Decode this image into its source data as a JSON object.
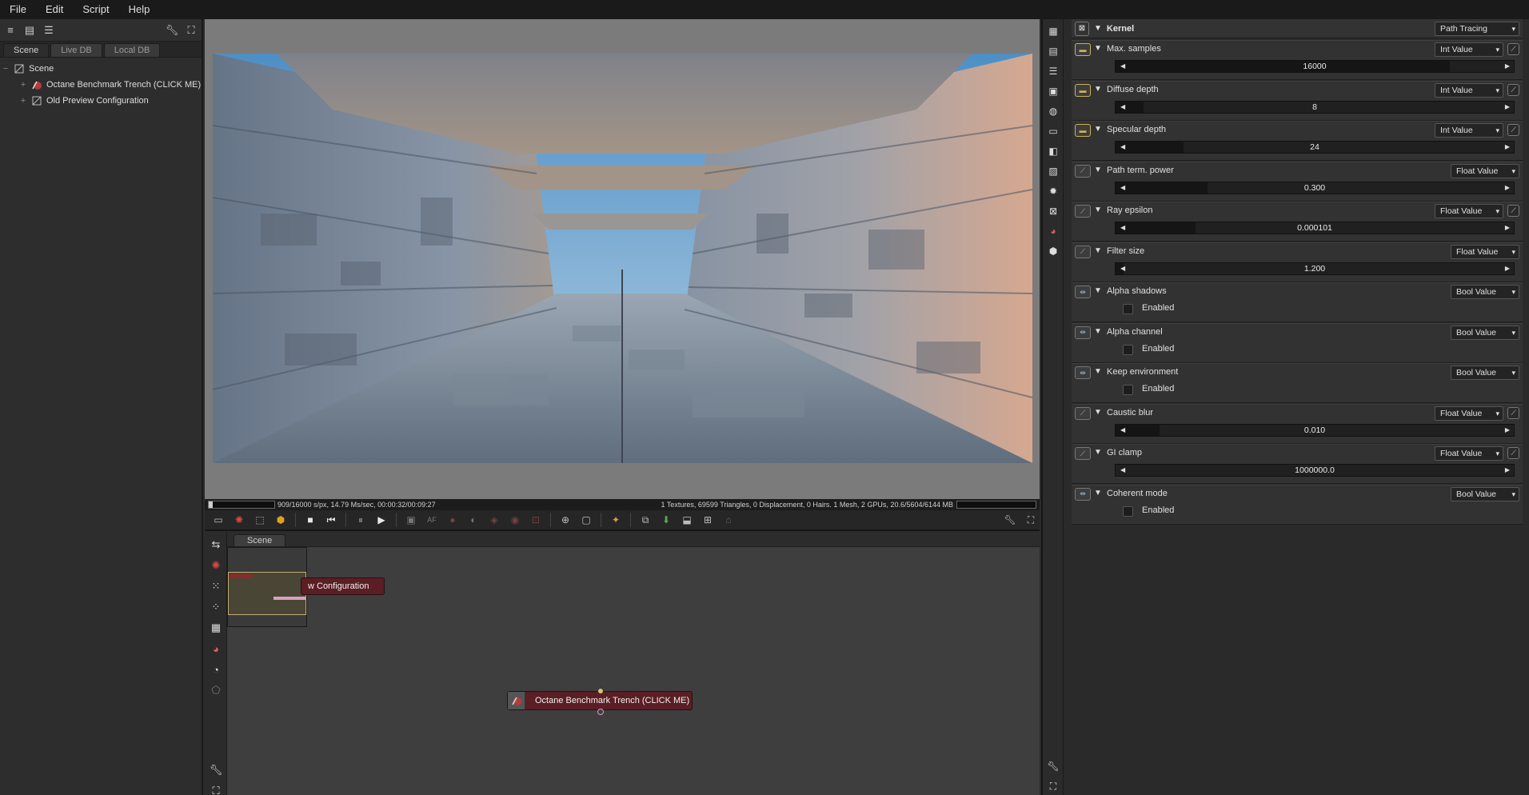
{
  "menu": [
    "File",
    "Edit",
    "Script",
    "Help"
  ],
  "left_panel": {
    "tabs": [
      "Scene",
      "Live DB",
      "Local DB"
    ],
    "tree": {
      "root": "Scene",
      "children": [
        "Octane Benchmark Trench (CLICK ME)",
        "Old Preview Configuration"
      ]
    }
  },
  "render": {
    "status_left": "909/16000 s/px, 14.79 Ms/sec, 00:00:32/00:09:27",
    "status_right": "1 Textures, 69599 Triangles, 0 Displacement, 0 Hairs. 1 Mesh, 2 GPUs, 20.6/5604/6144 MB",
    "progress": 0.057
  },
  "node_editor": {
    "tab": "Scene",
    "node_config": "w Configuration",
    "node_benchmark": "Octane Benchmark Trench (CLICK ME)"
  },
  "inspector": {
    "title": "Kernel",
    "kernel_type": "Path Tracing",
    "enabled_label": "Enabled",
    "params": [
      {
        "label": "Max. samples",
        "type": "Int Value",
        "value": "16000",
        "fill": 0.84
      },
      {
        "label": "Diffuse depth",
        "type": "Int Value",
        "value": "8",
        "fill": 0.07
      },
      {
        "label": "Specular depth",
        "type": "Int Value",
        "value": "24",
        "fill": 0.17
      },
      {
        "label": "Path term. power",
        "type": "Float Value",
        "value": "0.300",
        "fill": 0.23
      },
      {
        "label": "Ray epsilon",
        "type": "Float Value",
        "value": "0.000101",
        "fill": 0.2
      },
      {
        "label": "Filter size",
        "type": "Float Value",
        "value": "1.200",
        "fill": 0.02
      },
      {
        "label": "Alpha shadows",
        "type": "Bool Value"
      },
      {
        "label": "Alpha channel",
        "type": "Bool Value"
      },
      {
        "label": "Keep environment",
        "type": "Bool Value"
      },
      {
        "label": "Caustic blur",
        "type": "Float Value",
        "value": "0.010",
        "fill": 0.11
      },
      {
        "label": "GI clamp",
        "type": "Float Value",
        "value": "1000000.0",
        "fill": 0.0
      },
      {
        "label": "Coherent mode",
        "type": "Bool Value"
      }
    ]
  },
  "colors": {
    "node_red": "#5a1e24",
    "int_icon_border": "#c9b35a",
    "viewport_bg": "#7b7b7b"
  }
}
